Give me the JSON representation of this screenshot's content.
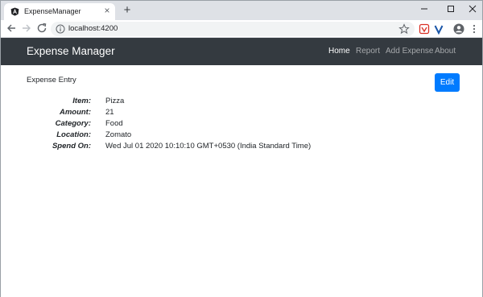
{
  "browser": {
    "tab_title": "ExpenseManager",
    "url": "localhost:4200"
  },
  "navbar": {
    "brand": "Expense Manager",
    "links": [
      {
        "label": "Home",
        "active": true
      },
      {
        "label": "Report",
        "active": false
      },
      {
        "label": "Add Expense",
        "active": false
      },
      {
        "label": "About",
        "active": false
      }
    ]
  },
  "main": {
    "title": "Expense Entry",
    "edit_label": "Edit",
    "details": [
      {
        "label": "Item:",
        "value": "Pizza"
      },
      {
        "label": "Amount:",
        "value": "21"
      },
      {
        "label": "Category:",
        "value": "Food"
      },
      {
        "label": "Location:",
        "value": "Zomato"
      },
      {
        "label": "Spend On:",
        "value": "Wed Jul 01 2020 10:10:10 GMT+0530 (India Standard Time)"
      }
    ]
  },
  "colors": {
    "navbar_bg": "#343a40",
    "primary": "#007bff",
    "tabstrip_bg": "#dee1e6"
  }
}
